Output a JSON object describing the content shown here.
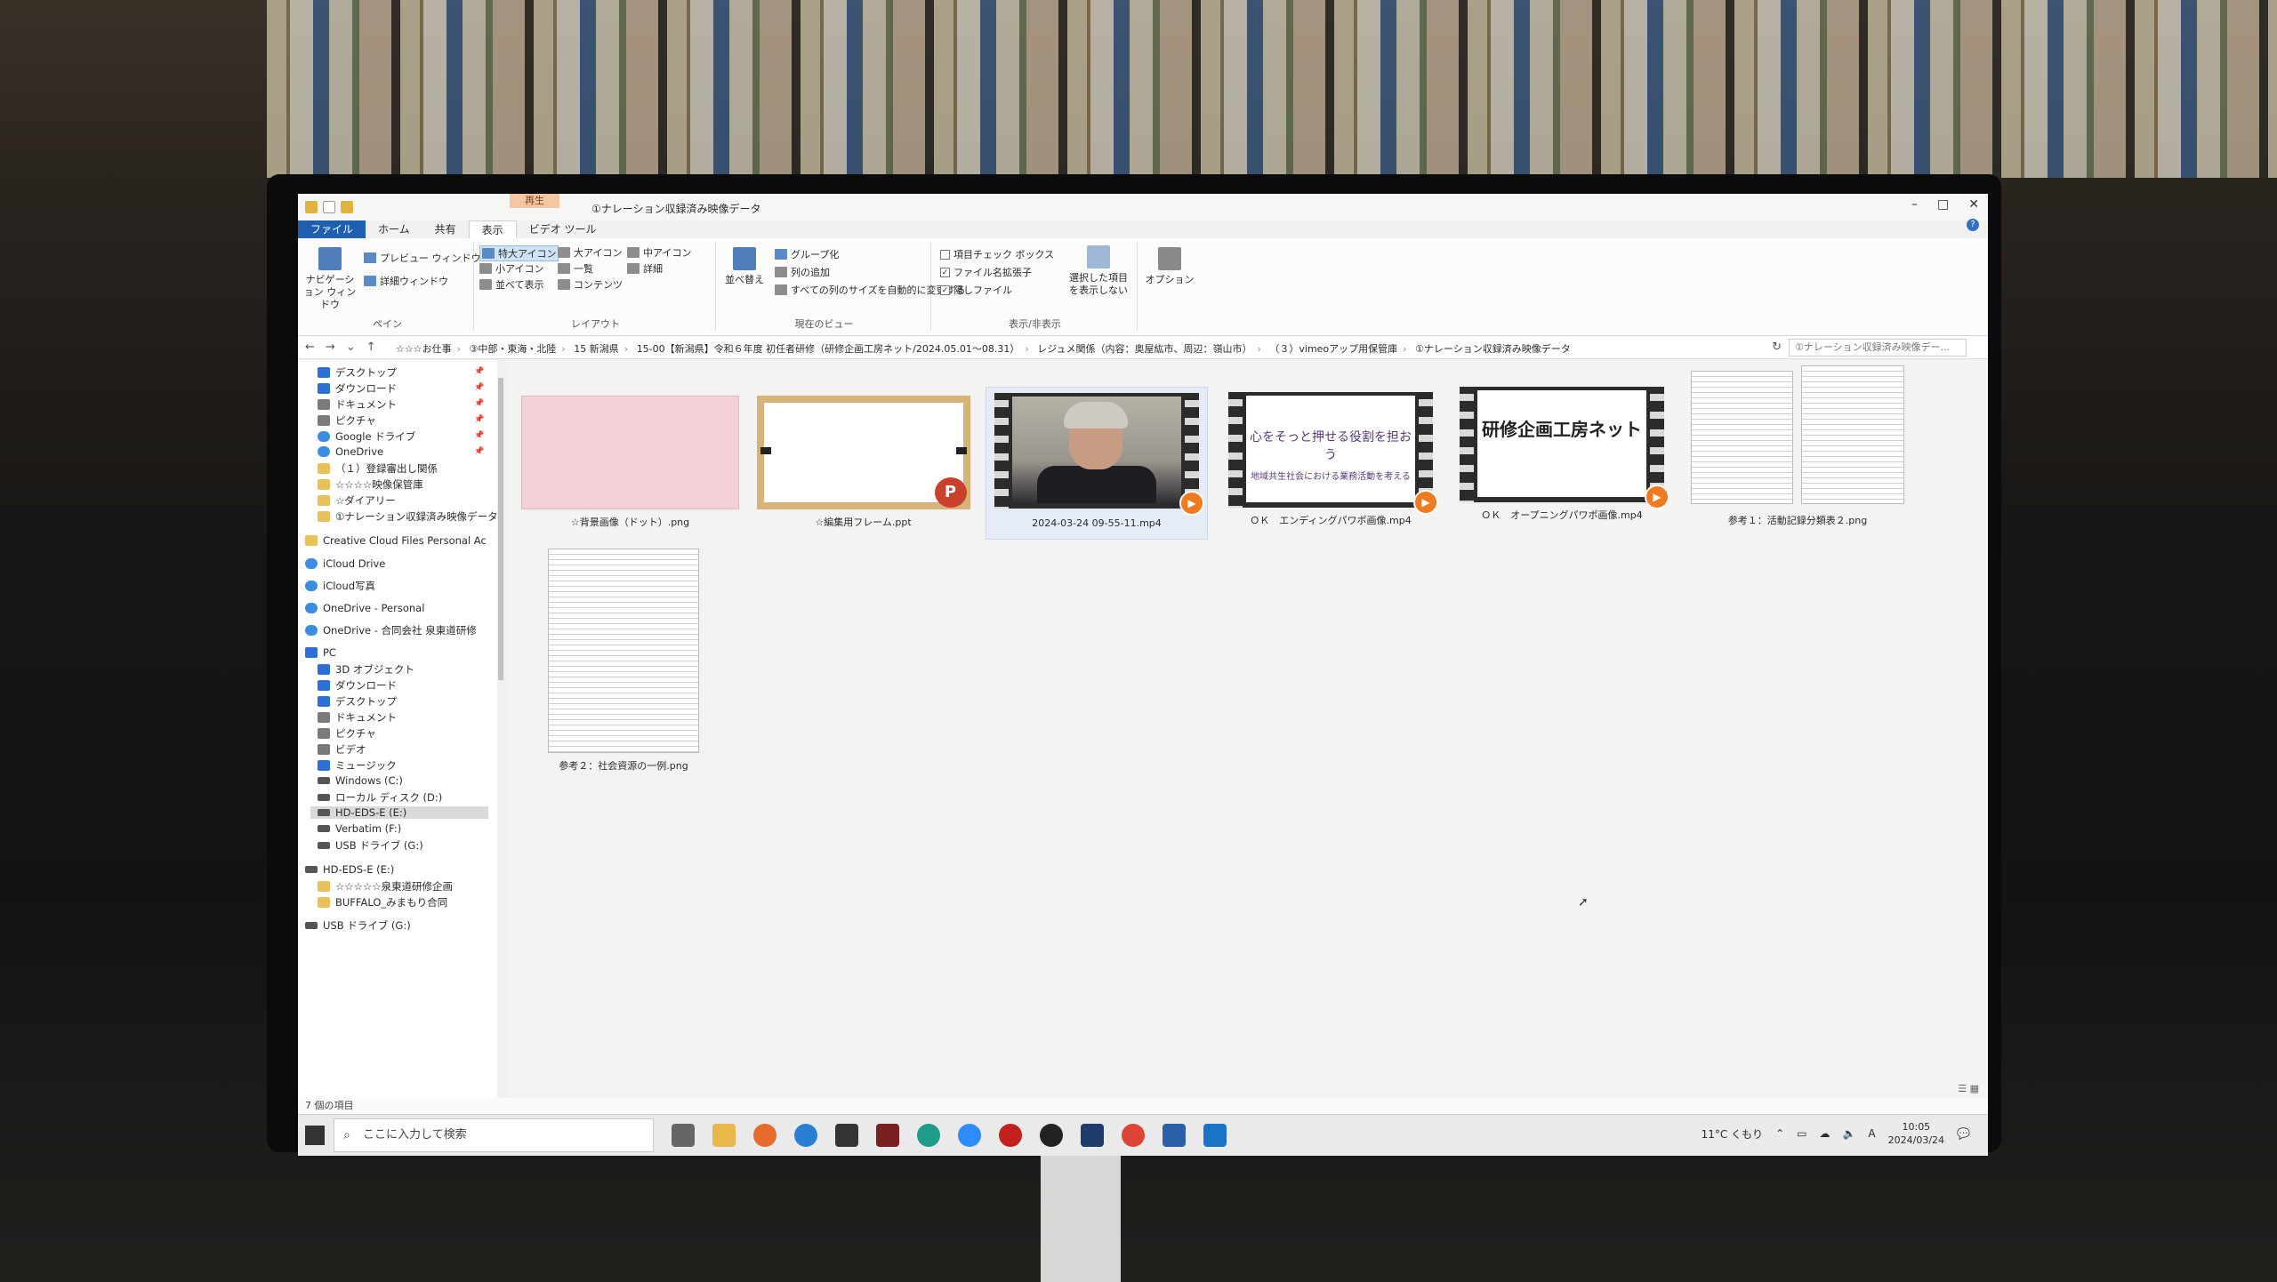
{
  "window": {
    "title": "①ナレーション収録済み映像データ",
    "context_tab_group": "再生",
    "minimize": "–",
    "maximize": "□",
    "close": "✕",
    "help": "?"
  },
  "ribbon_tabs": [
    "ファイル",
    "ホーム",
    "共有",
    "表示",
    "ビデオ ツール"
  ],
  "ribbon": {
    "pane": {
      "nav_pane": "ナビゲーション ウィンドウ",
      "preview_pane": "プレビュー ウィンドウ",
      "details_pane": "詳細ウィンドウ",
      "group": "ペイン"
    },
    "layout": {
      "xl_icons": "特大アイコン",
      "large_icons": "大アイコン",
      "medium_icons": "中アイコン",
      "small_icons": "小アイコン",
      "list": "一覧",
      "details": "詳細",
      "tiles": "並べて表示",
      "content": "コンテンツ",
      "group": "レイアウト"
    },
    "current_view": {
      "sort_by": "並べ替え",
      "group_by": "グループ化",
      "add_columns": "列の追加",
      "size_columns": "すべての列のサイズを自動的に変更する",
      "group": "現在のビュー"
    },
    "show_hide": {
      "item_checkboxes": "項目チェック ボックス",
      "file_extensions": "ファイル名拡張子",
      "hidden_items": "隠しファイル",
      "hide_selected": "選択した項目を表示しない",
      "group": "表示/非表示"
    },
    "options": "オプション"
  },
  "address": {
    "crumbs": [
      "☆☆☆お仕事",
      "③中部・東海・北陸",
      "15 新潟県",
      "15-00【新潟県】令和６年度 初任者研修（研修企画工房ネット/2024.05.01〜08.31）",
      "レジュメ関係（内容：奥屋紘市、周辺：嶺山市）",
      "（３）vimeoアップ用保管庫",
      "①ナレーション収録済み映像データ"
    ],
    "search_placeholder": "①ナレーション収録済み映像デー..."
  },
  "nav": {
    "quick_access": [
      {
        "label": "デスクトップ",
        "pinned": true
      },
      {
        "label": "ダウンロード",
        "pinned": true
      },
      {
        "label": "ドキュメント",
        "pinned": true
      },
      {
        "label": "ピクチャ",
        "pinned": true
      },
      {
        "label": "Google ドライブ",
        "pinned": true
      },
      {
        "label": "OneDrive",
        "pinned": true
      },
      {
        "label": "（１）登録審出し関係",
        "pinned": false
      },
      {
        "label": "☆☆☆☆映像保管庫",
        "pinned": false
      },
      {
        "label": "☆ダイアリー",
        "pinned": false
      },
      {
        "label": "①ナレーション収録済み映像データ",
        "pinned": false
      }
    ],
    "others": [
      "Creative Cloud Files Personal Ac",
      "iCloud Drive",
      "iCloud写真",
      "OneDrive - Personal",
      "OneDrive - 合同会社 泉東道研修"
    ],
    "pc_label": "PC",
    "pc": [
      "3D オブジェクト",
      "ダウンロード",
      "デスクトップ",
      "ドキュメント",
      "ピクチャ",
      "ビデオ",
      "ミュージック",
      "Windows (C:)",
      "ローカル ディスク (D:)",
      "HD-EDS-E (E:)",
      "Verbatim (F:)",
      "USB ドライブ (G:)"
    ],
    "drive_e": "HD-EDS-E (E:)",
    "drive_e_children": [
      "☆☆☆☆☆泉東道研修企画",
      "BUFFALO_みまもり合同"
    ],
    "usb_g": "USB ドライブ (G:)"
  },
  "files": [
    {
      "name": "☆背景画像（ドット）.png",
      "kind": "pink-image"
    },
    {
      "name": "☆編集用フレーム.ppt",
      "kind": "ppt"
    },
    {
      "name": "2024-03-24 09-55-11.mp4",
      "kind": "video-person"
    },
    {
      "name": "ＯＫ　エンディングパワポ画像.mp4",
      "kind": "video-slide",
      "slide_text": "心をそっと押せる役割を担おう",
      "slide_sub": "地域共生社会における業務活動を考える"
    },
    {
      "name": "ＯＫ　オープニングパワポ画像.mp4",
      "kind": "video-title",
      "slide_text": "研修企画工房ネット"
    },
    {
      "name": "参考１：活動記録分類表２.png",
      "kind": "doc"
    },
    {
      "name": "参考２：社会資源の一例.png",
      "kind": "doc"
    }
  ],
  "status": {
    "item_count": "7 個の項目"
  },
  "taskbar": {
    "search_placeholder": "ここに入力して検索",
    "weather": "11°C くもり",
    "ime": "A",
    "time": "10:05",
    "date": "2024/03/24"
  }
}
